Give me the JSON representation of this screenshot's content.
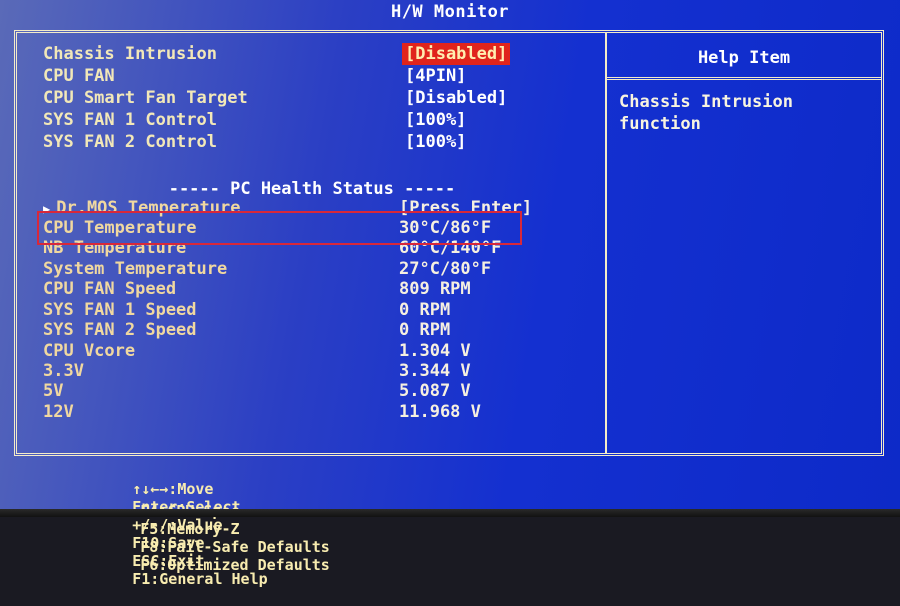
{
  "title": "H/W Monitor",
  "settings": [
    {
      "label": "Chassis Intrusion",
      "value": "[Disabled]",
      "selected": true
    },
    {
      "label": "CPU FAN",
      "value": "[4PIN]"
    },
    {
      "label": "CPU Smart Fan Target",
      "value": "[Disabled]"
    },
    {
      "label": "SYS FAN 1 Control",
      "value": "[100%]"
    },
    {
      "label": "SYS FAN 2 Control",
      "value": "[100%]"
    }
  ],
  "section_title": "----- PC Health Status -----",
  "status": [
    {
      "label": "Dr.MOS Temperature",
      "value": "[Press Enter]",
      "submenu": true
    },
    {
      "label": "CPU Temperature",
      "value": "30°C/86°F",
      "highlighted": true
    },
    {
      "label": "NB Temperature",
      "value": "60°C/140°F"
    },
    {
      "label": "System Temperature",
      "value": "27°C/80°F"
    },
    {
      "label": "CPU FAN Speed",
      "value": "809 RPM"
    },
    {
      "label": "SYS FAN 1 Speed",
      "value": "0 RPM"
    },
    {
      "label": "SYS FAN 2 Speed",
      "value": "0 RPM"
    },
    {
      "label": "CPU Vcore",
      "value": "1.304 V"
    },
    {
      "label": "3.3V",
      "value": "3.344 V"
    },
    {
      "label": "5V",
      "value": "5.087 V"
    },
    {
      "label": "12V",
      "value": "11.968 V"
    }
  ],
  "help": {
    "header": "Help Item",
    "text": "Chassis Intrusion function"
  },
  "footer": {
    "line1": [
      "↑↓←→:Move",
      "Enter:Select",
      "+/-/:Value",
      "F10:Save",
      "ESC:Exit",
      "F1:General Help"
    ],
    "line2": [
      "F4:CPU Spec",
      "F5:Memory-Z",
      "F8:Fail-Safe Defaults",
      "F6:Optimized Defaults"
    ]
  },
  "colors": {
    "background": "#1430d0",
    "selection": "#e0241c",
    "highlight_box": "#d8283a",
    "label_text": "#f2e8b8",
    "border": "#f4ecc8"
  }
}
